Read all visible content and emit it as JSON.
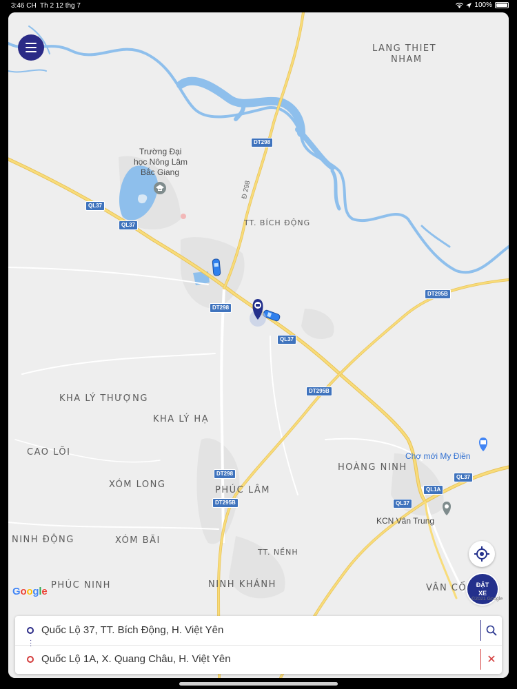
{
  "status_bar": {
    "time": "3:46 CH",
    "date": "Th 2 12 thg 7",
    "battery": "100%"
  },
  "map": {
    "area_labels": {
      "lang_thiet_nham_1": "LANG THIET",
      "lang_thiet_nham_2": "NHAM",
      "tt_bich_dong": "TT. BÍCH ĐỘNG",
      "kha_ly_thuong": "KHA LÝ THƯỢNG",
      "kha_ly_ha": "KHA LÝ HẠ",
      "cao_loi": "CAO LÕI",
      "xom_long": "XÓM LONG",
      "hoang_ninh": "HOÀNG NINH",
      "phuc_lam": "PHÚC LÂM",
      "ninh_dong": "NINH ĐỘNG",
      "xom_bai": "XÓM BÃI",
      "tt_nenh": "TT. NỀNH",
      "phuc_ninh": "PHÚC NINH",
      "ninh_khanh": "NINH KHÁNH",
      "van_co": "VÂN CỐ"
    },
    "poi": {
      "university_1": "Trường Đại",
      "university_2": "học Nông Lâm",
      "university_3": "Bắc Giang",
      "market": "Chợ mới My Điền",
      "industrial_zone": "KCN Vân Trung"
    },
    "road_shields": {
      "dt298_a": "DT298",
      "dt298_b": "DT298",
      "dt298_c": "DT298",
      "ql37_a": "QL37",
      "ql37_b": "QL37",
      "ql37_c": "QL37",
      "ql37_d": "QL37",
      "ql37_e": "QL37",
      "dt295b_a": "DT295B",
      "dt295b_b": "DT295B",
      "dt295b_c": "DT295B",
      "ql1a": "QL1A"
    },
    "road_name": "Đ 298",
    "google": {
      "g1": "G",
      "o1": "o",
      "o2": "o",
      "g2": "g",
      "l": "l",
      "e": "e"
    },
    "copyright": "©2021 Google"
  },
  "buttons": {
    "book_line1": "ĐẶT",
    "book_line2": "XE"
  },
  "route": {
    "from": "Quốc Lộ 37, TT. Bích Động, H. Việt Yên",
    "to": "Quốc Lộ 1A, X. Quang Châu, H. Việt Yên",
    "clear_symbol": "✕"
  },
  "colors": {
    "water": "#8ebfec",
    "major_road": "#f5d76e",
    "brand": "#2a2a86",
    "destination": "#d33b3b"
  }
}
